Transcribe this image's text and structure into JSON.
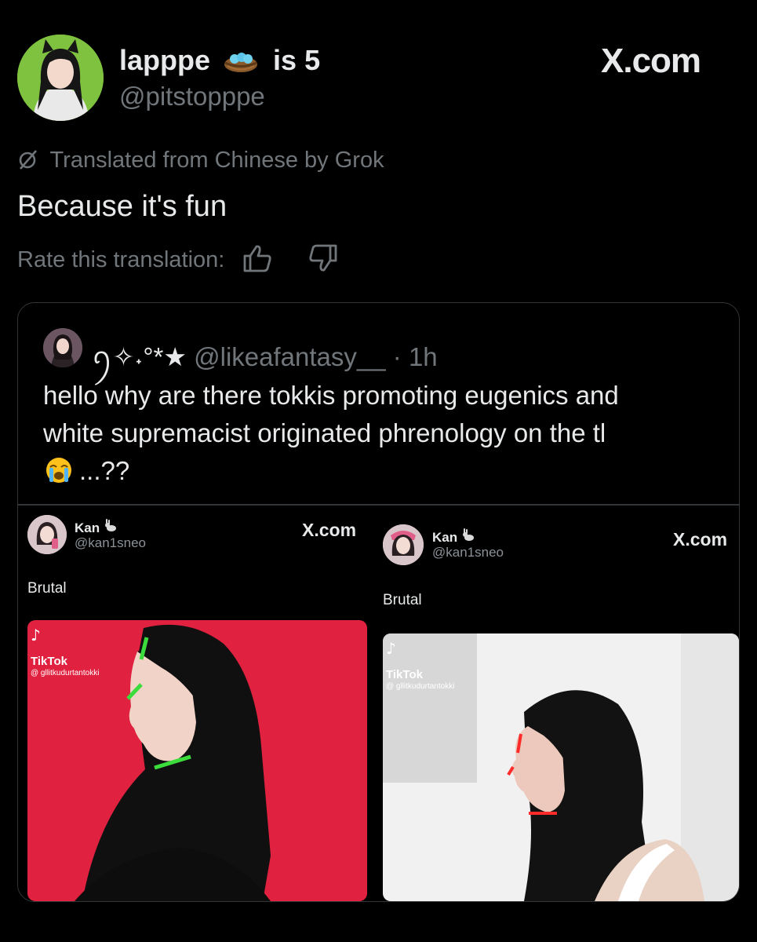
{
  "post": {
    "author": {
      "name": "lapppe",
      "name_suffix": "is 5",
      "handle": "@pitstopppe"
    },
    "brand": "X.com",
    "translated_note": "Translated from Chinese by Grok",
    "text": "Because it's fun",
    "rate_label": "Rate this translation:",
    "icons": [
      "nest-emoji-icon",
      "translate-icon",
      "thumbs-up-icon",
      "thumbs-down-icon"
    ]
  },
  "quote": {
    "name_decor": "ꪆ✧˖°*★",
    "handle": "@likeafantasy__",
    "time": "· 1h",
    "text_lines": [
      "hello why are there tokkis promoting eugenics and",
      "white supremacist originated phrenology on the tl"
    ],
    "text_end": "...??"
  },
  "screenshots": [
    {
      "name": "Kan",
      "handle": "@kan1sneo",
      "brand": "X.com",
      "text": "Brutal",
      "tiktok_label": "TikTok",
      "tiktok_user": "@ gllitkudurtantokki",
      "bg": "#e0213f",
      "line_color": "#3ddc3d"
    },
    {
      "name": "Kan",
      "handle": "@kan1sneo",
      "brand": "X.com",
      "text": "Brutal",
      "tiktok_label": "TikTok",
      "tiktok_user": "@ gllitkudurtantokki",
      "bg": "#f1f1f1",
      "line_color": "#ff2a2a"
    }
  ]
}
